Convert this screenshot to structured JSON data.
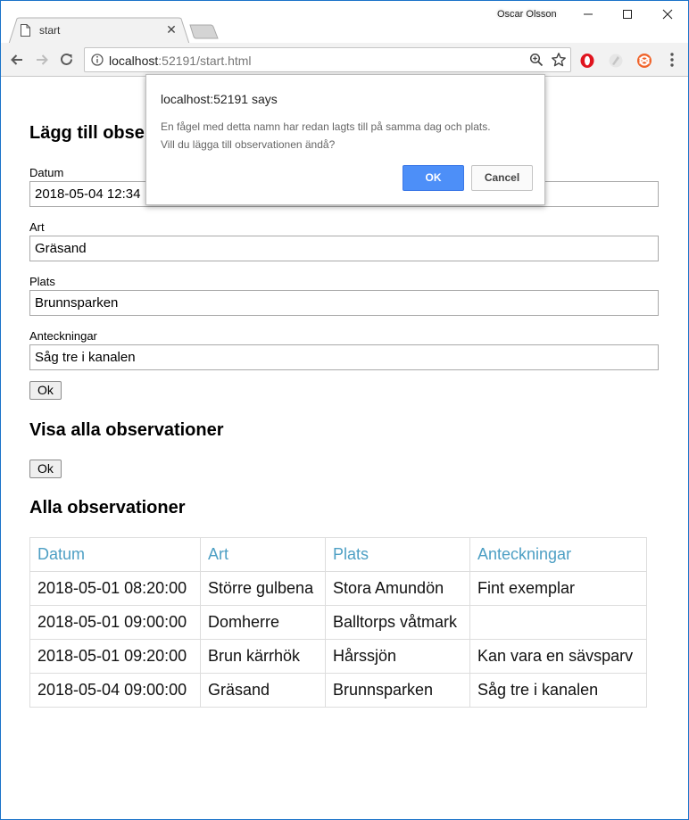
{
  "browser": {
    "tab_title": "start",
    "user_name": "Oscar Olsson",
    "url_host": "localhost",
    "url_rest": ":52191/start.html",
    "icons": [
      "document-icon",
      "close-icon",
      "new-tab-icon",
      "minimize-icon",
      "maximize-icon",
      "window-close-icon",
      "back-icon",
      "forward-icon",
      "reload-icon",
      "info-icon",
      "zoom-icon",
      "star-icon",
      "opera-icon",
      "extension-icon",
      "extension-orange-icon",
      "menu-dots-icon"
    ]
  },
  "form": {
    "heading": "Lägg till observation",
    "date_label": "Datum",
    "date_value": "2018-05-04 12:34",
    "species_label": "Art",
    "species_value": "Gräsand",
    "place_label": "Plats",
    "place_value": "Brunnsparken",
    "notes_label": "Anteckningar",
    "notes_value": "Såg tre i kanalen",
    "submit_label": "Ok"
  },
  "show_all": {
    "heading": "Visa alla observationer",
    "button_label": "Ok"
  },
  "table": {
    "heading": "Alla observationer",
    "columns": [
      "Datum",
      "Art",
      "Plats",
      "Anteckningar"
    ],
    "rows": [
      [
        "2018-05-01 08:20:00",
        "Större gulbena",
        "Stora Amundön",
        "Fint exemplar"
      ],
      [
        "2018-05-01 09:00:00",
        "Domherre",
        "Balltorps våtmark",
        ""
      ],
      [
        "2018-05-01 09:20:00",
        "Brun kärrhök",
        "Hårssjön",
        "Kan vara en sävsparv"
      ],
      [
        "2018-05-04 09:00:00",
        "Gräsand",
        "Brunnsparken",
        "Såg tre i kanalen"
      ]
    ]
  },
  "dialog": {
    "title": "localhost:52191 says",
    "message_line1": "En fågel med detta namn har redan lagts till på samma dag och plats.",
    "message_line2": "Vill du lägga till observationen ändå?",
    "ok_label": "OK",
    "cancel_label": "Cancel"
  },
  "colors": {
    "table_header": "#4d9fc4",
    "dialog_ok": "#4d8ff8",
    "window_border": "#1a73c9"
  }
}
